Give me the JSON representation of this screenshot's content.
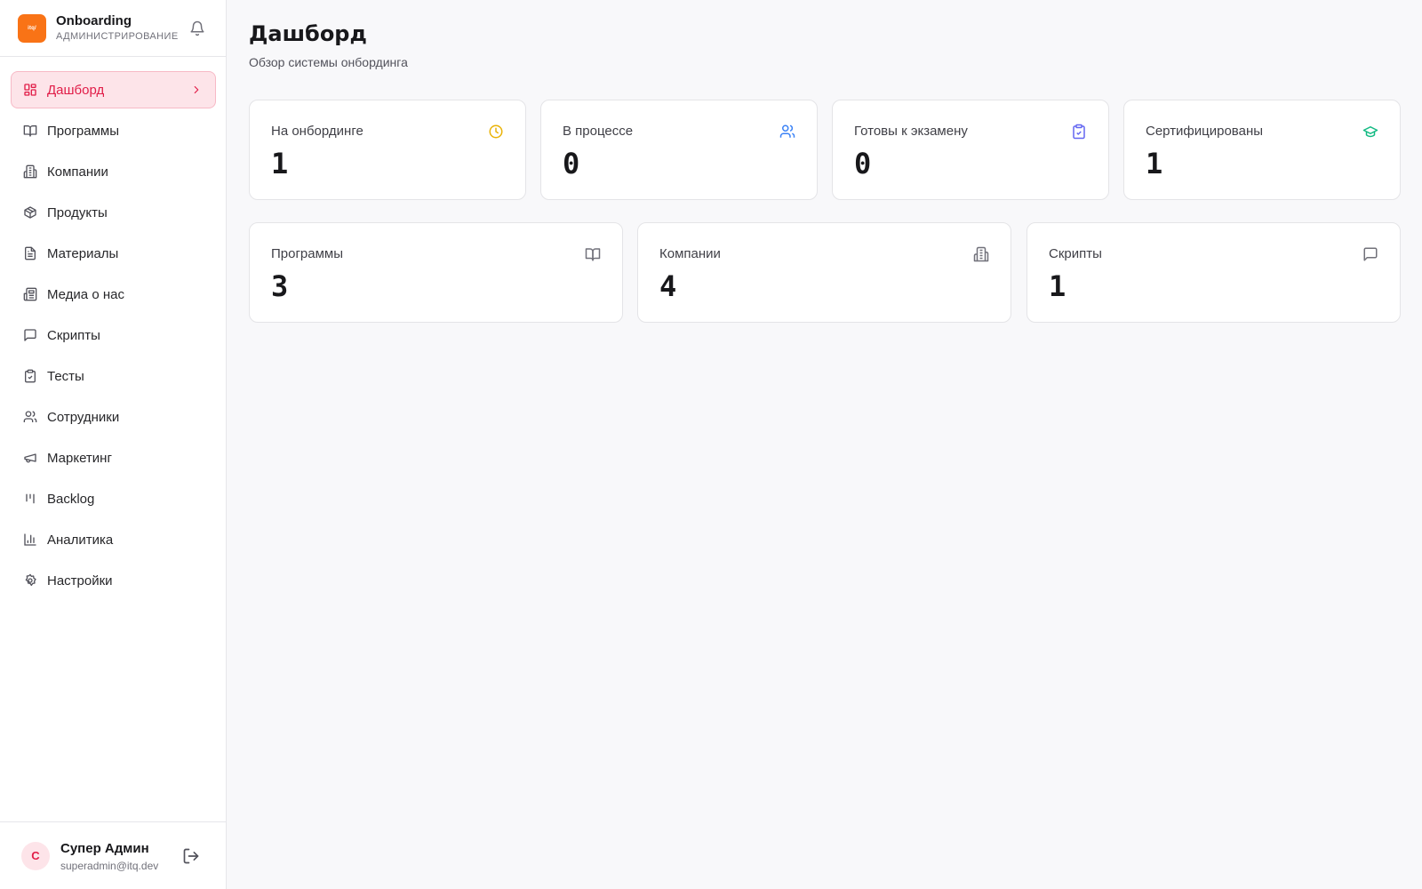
{
  "sidebar": {
    "logo_text": "itq/",
    "app_name": "Onboarding",
    "app_subtitle": "АДМИНИСТРИРОВАНИЕ",
    "nav": [
      {
        "label": "Дашборд",
        "icon": "dashboard-icon",
        "active": true
      },
      {
        "label": "Программы",
        "icon": "book-icon"
      },
      {
        "label": "Компании",
        "icon": "building-icon"
      },
      {
        "label": "Продукты",
        "icon": "package-icon"
      },
      {
        "label": "Материалы",
        "icon": "file-text-icon"
      },
      {
        "label": "Медиа о нас",
        "icon": "newspaper-icon"
      },
      {
        "label": "Скрипты",
        "icon": "message-square-icon"
      },
      {
        "label": "Тесты",
        "icon": "clipboard-check-icon"
      },
      {
        "label": "Сотрудники",
        "icon": "users-icon"
      },
      {
        "label": "Маркетинг",
        "icon": "megaphone-icon"
      },
      {
        "label": "Backlog",
        "icon": "kanban-icon"
      },
      {
        "label": "Аналитика",
        "icon": "bar-chart-icon"
      },
      {
        "label": "Настройки",
        "icon": "settings-icon"
      }
    ],
    "user": {
      "initial": "С",
      "name": "Супер Админ",
      "email": "superadmin@itq.dev"
    }
  },
  "main": {
    "title": "Дашборд",
    "subtitle": "Обзор системы онбординга",
    "stats_top": [
      {
        "label": "На онбординге",
        "value": "1",
        "icon": "clock-icon",
        "color": "#eab308"
      },
      {
        "label": "В процессе",
        "value": "0",
        "icon": "users-icon",
        "color": "#3b82f6"
      },
      {
        "label": "Готовы к экзамену",
        "value": "0",
        "icon": "clipboard-check-icon",
        "color": "#6366f1"
      },
      {
        "label": "Сертифицированы",
        "value": "1",
        "icon": "graduation-cap-icon",
        "color": "#10b981"
      }
    ],
    "stats_bottom": [
      {
        "label": "Программы",
        "value": "3",
        "icon": "book-icon",
        "color": "#71717a"
      },
      {
        "label": "Компании",
        "value": "4",
        "icon": "building-icon",
        "color": "#71717a"
      },
      {
        "label": "Скрипты",
        "value": "1",
        "icon": "message-square-icon",
        "color": "#71717a"
      }
    ]
  },
  "colors": {
    "accent": "#e11d48",
    "accent_bg": "#fde4e9",
    "brand": "#f97316"
  }
}
